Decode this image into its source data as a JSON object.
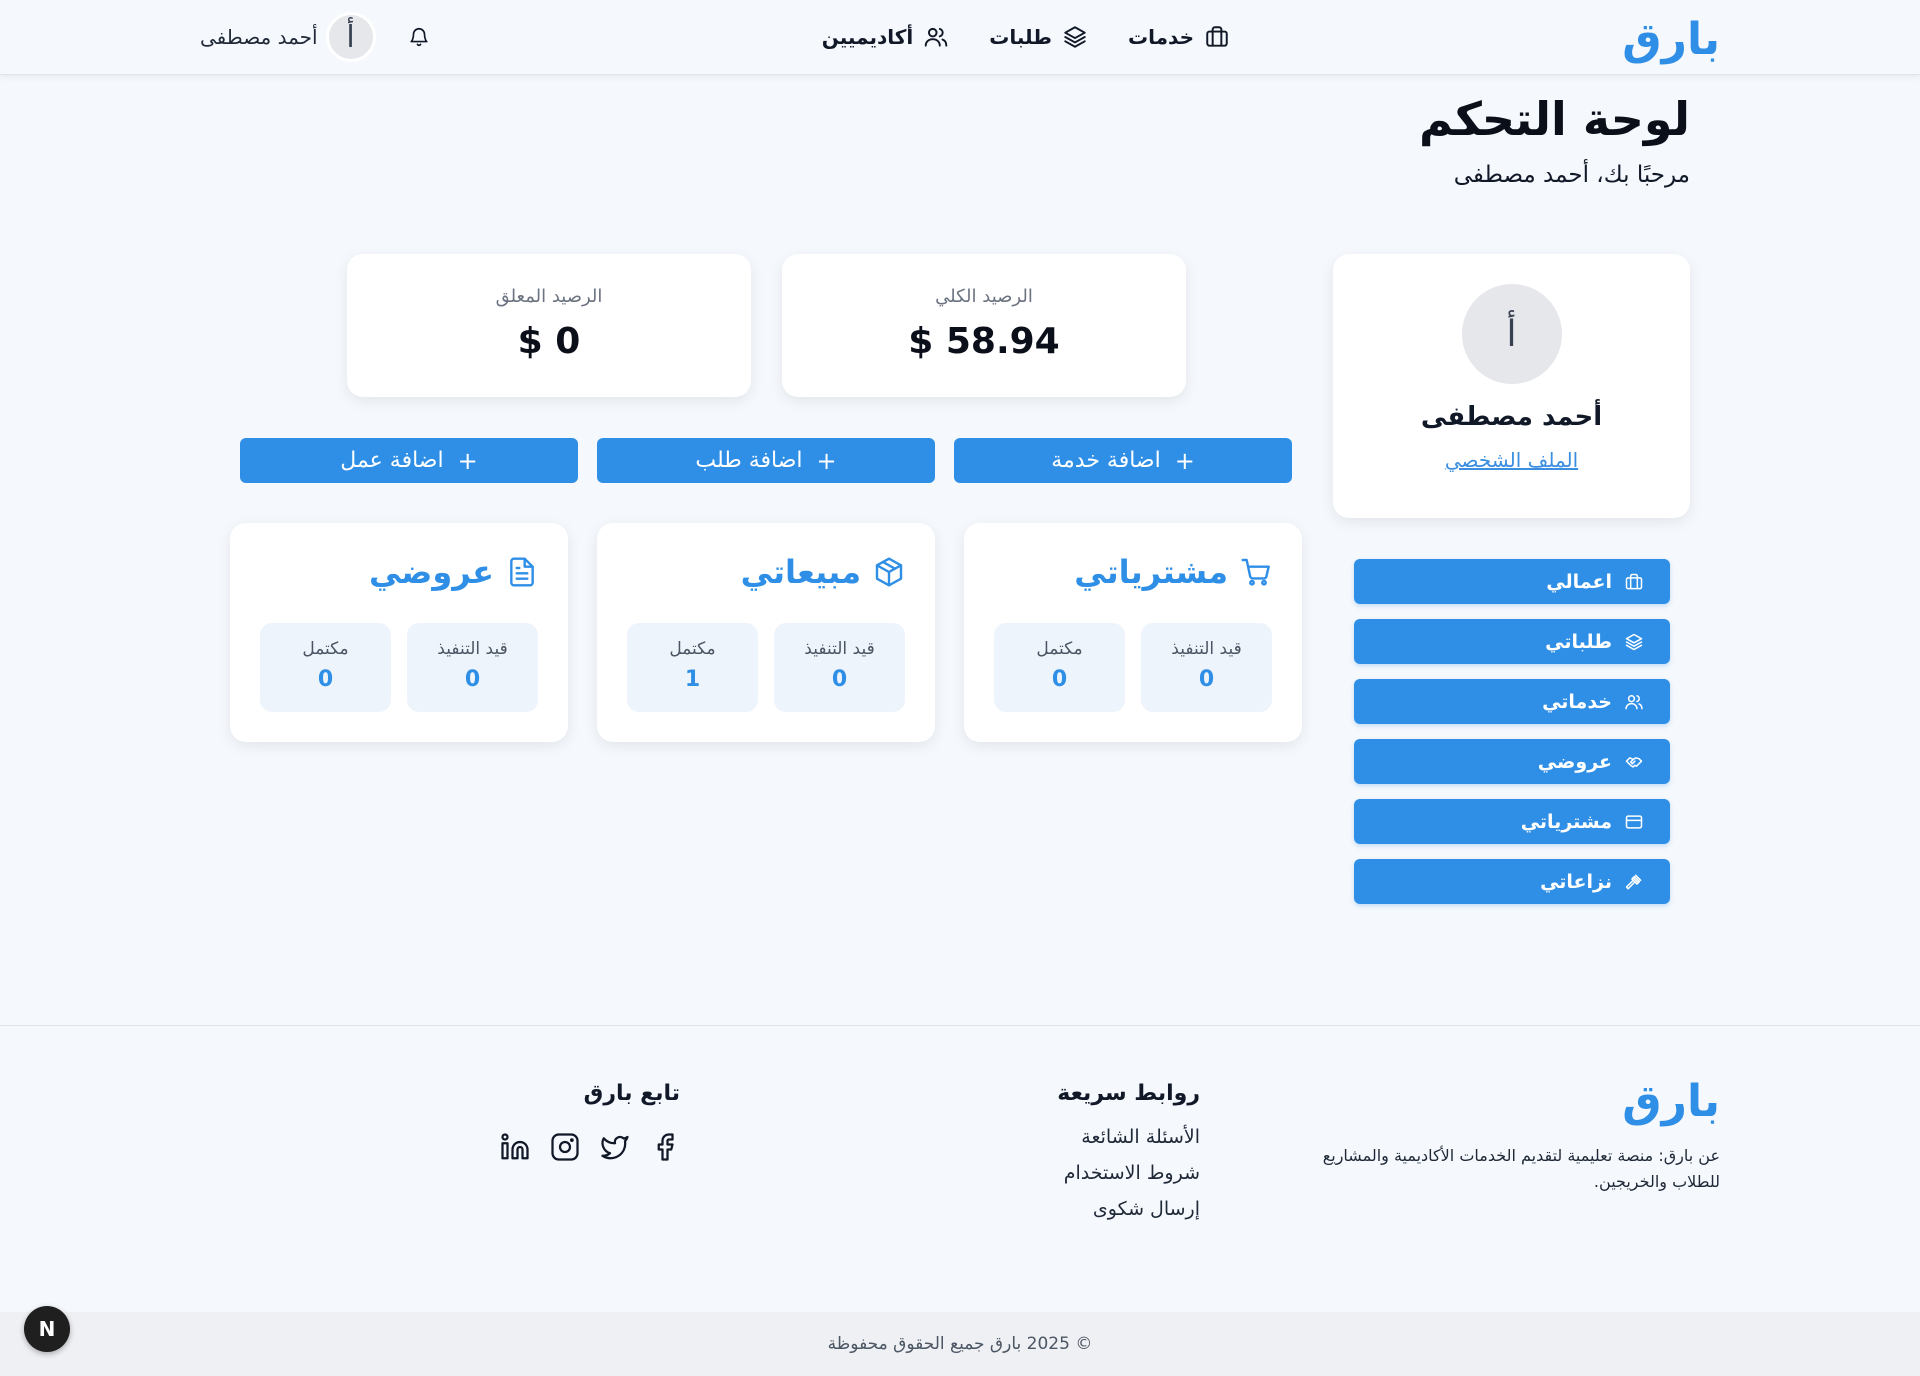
{
  "header": {
    "brand": "بارق",
    "nav": [
      {
        "label": "خدمات",
        "icon": "briefcase-icon"
      },
      {
        "label": "طلبات",
        "icon": "layers-icon"
      },
      {
        "label": "أكاديميين",
        "icon": "users-icon"
      }
    ],
    "user_name": "أحمد مصطفى",
    "avatar_initial": "أ",
    "bell_icon": "bell-icon"
  },
  "page": {
    "title": "لوحة التحكم",
    "welcome": "مرحبًا بك، أحمد مصطفى"
  },
  "profile": {
    "avatar_initial": "أ",
    "name": "أحمد مصطفى",
    "link": "الملف الشخصي"
  },
  "side_menu": [
    {
      "label": "اعمالي",
      "icon": "briefcase-icon"
    },
    {
      "label": "طلباتي",
      "icon": "layers-icon"
    },
    {
      "label": "خدماتي",
      "icon": "users-icon"
    },
    {
      "label": "عروضي",
      "icon": "handshake-icon"
    },
    {
      "label": "مشترياتي",
      "icon": "credit-card-icon"
    },
    {
      "label": "نزاعاتي",
      "icon": "gavel-icon"
    }
  ],
  "balances": {
    "total_label": "الرصيد الكلي",
    "total_value": "$ 58.94",
    "pending_label": "الرصيد المعلق",
    "pending_value": "$ 0"
  },
  "add_buttons": {
    "service": "اضافة خدمة",
    "request": "اضافة طلب",
    "work": "اضافة عمل",
    "plus": "+"
  },
  "stats": {
    "purchases": {
      "title": "مشترياتي",
      "icon": "cart-icon",
      "in_progress_label": "قيد التنفيذ",
      "in_progress": "0",
      "done_label": "مكتمل",
      "done": "0"
    },
    "sales": {
      "title": "مبيعاتي",
      "icon": "package-icon",
      "in_progress_label": "قيد التنفيذ",
      "in_progress": "0",
      "done_label": "مكتمل",
      "done": "1"
    },
    "offers": {
      "title": "عروضي",
      "icon": "document-icon",
      "in_progress_label": "قيد التنفيذ",
      "in_progress": "0",
      "done_label": "مكتمل",
      "done": "0"
    }
  },
  "footer": {
    "brand": "بارق",
    "about": "عن بارق: منصة تعليمية لتقديم الخدمات الأكاديمية والمشاريع للطلاب والخريجين.",
    "links_title": "روابط سريعة",
    "links": [
      "الأسئلة الشائعة",
      "شروط الاستخدام",
      "إرسال شكوى"
    ],
    "follow_title": "تابع بارق",
    "social": [
      "facebook-icon",
      "twitter-icon",
      "instagram-icon",
      "linkedin-icon"
    ],
    "copyright": "© 2025 بارق جميع الحقوق محفوظة"
  },
  "dev_badge": "N",
  "colors": {
    "accent": "#2f8fe6",
    "background": "#f5f8fd",
    "card": "#ffffff"
  }
}
